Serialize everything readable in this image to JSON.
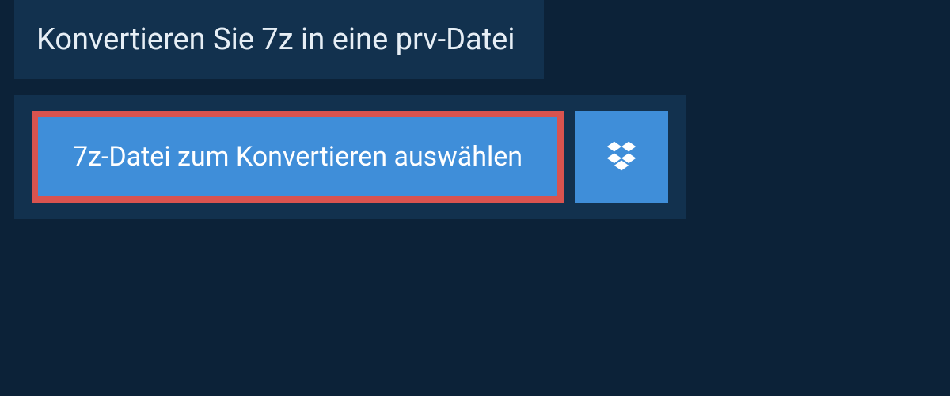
{
  "header": {
    "title": "Konvertieren Sie 7z in eine prv-Datei"
  },
  "actions": {
    "select_file_label": "7z-Datei zum Konvertieren auswählen",
    "dropbox_icon": "dropbox"
  },
  "colors": {
    "page_bg": "#0c2238",
    "panel_bg": "#12314e",
    "button_bg": "#3f8ed9",
    "highlight_border": "#d9534f",
    "text_light": "#ffffff"
  }
}
